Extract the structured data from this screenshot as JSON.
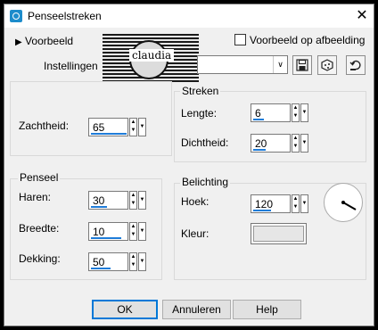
{
  "window": {
    "title": "Penseelstreken",
    "close_glyph": "✕"
  },
  "top": {
    "preview_label": "Voorbeeld",
    "preview_on_image_label": "Voorbeeld op afbeelding",
    "settings_label": "Instellingen",
    "settings_value": "",
    "logo_text": "claudia"
  },
  "groups": {
    "general": {
      "softness": {
        "label": "Zachtheid:",
        "value": "65"
      }
    },
    "strokes": {
      "title": "Streken",
      "length": {
        "label": "Lengte:",
        "value": "6"
      },
      "density": {
        "label": "Dichtheid:",
        "value": "20"
      }
    },
    "brush": {
      "title": "Penseel",
      "bristles": {
        "label": "Haren:",
        "value": "30"
      },
      "width": {
        "label": "Breedte:",
        "value": "10"
      },
      "opacity": {
        "label": "Dekking:",
        "value": "50"
      }
    },
    "lighting": {
      "title": "Belichting",
      "angle": {
        "label": "Hoek:",
        "value": "120"
      },
      "color": {
        "label": "Kleur:",
        "hex": "#e6e6e6"
      }
    }
  },
  "buttons": {
    "ok": "OK",
    "cancel": "Annuleren",
    "help": "Help"
  },
  "icons": [
    "app-icon",
    "close-icon",
    "save-icon",
    "randomize-icon",
    "reset-icon",
    "angle-dial-icon"
  ]
}
